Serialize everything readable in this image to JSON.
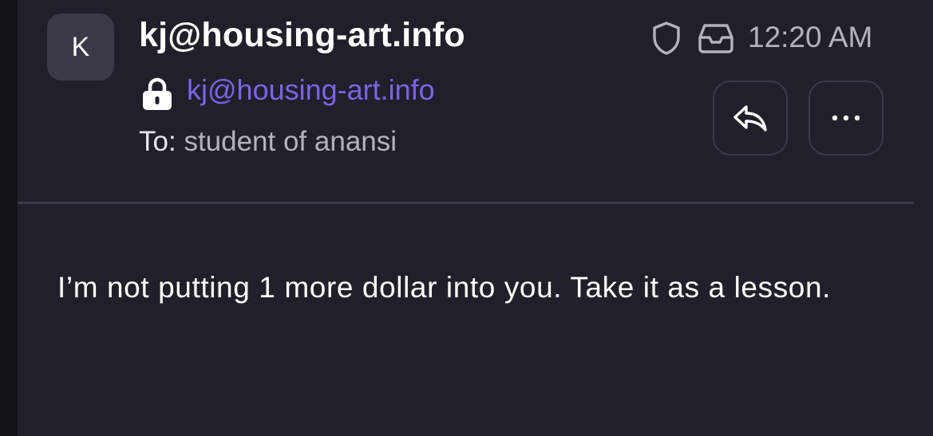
{
  "message": {
    "avatar_initial": "K",
    "sender_name": "kj@housing-art.info",
    "sender_address": "kj@housing-art.info",
    "recipient_prefix": "To:",
    "recipient_name": "student of anansi",
    "time": "12:20 AM",
    "body": "I’m not putting 1 more dollar into you. Take it as a lesson."
  },
  "icons": {
    "lock": "lock-icon",
    "shield": "shield-icon",
    "inbox": "inbox-icon",
    "reply": "reply-arrow-icon",
    "more": "more-dots-icon"
  },
  "colors": {
    "background": "#211f2a",
    "accent": "#7c63ea",
    "muted_text": "#b4b2bc"
  }
}
